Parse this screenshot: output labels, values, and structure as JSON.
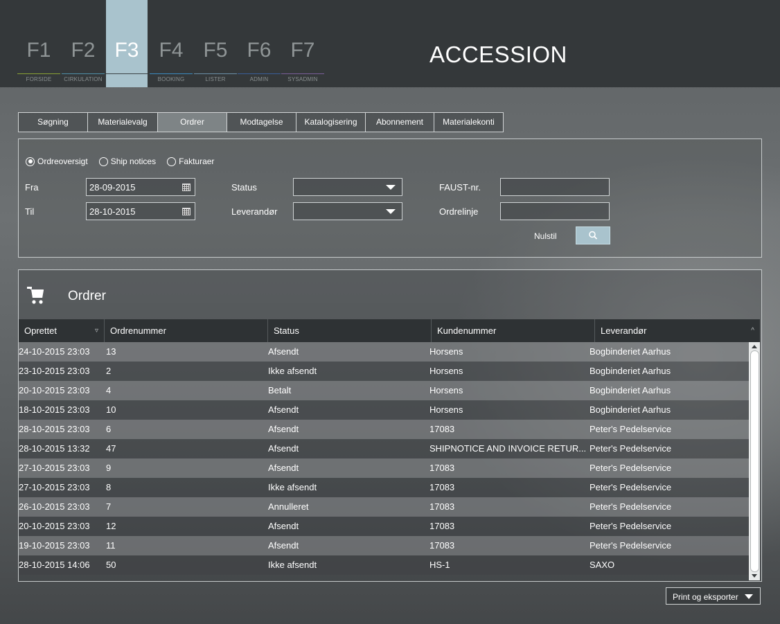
{
  "nav": {
    "keys": [
      {
        "key": "F1",
        "label": "FORSIDE",
        "color": "#8aa234"
      },
      {
        "key": "F2",
        "label": "CIRKULATION",
        "color": "#4f8fa8"
      },
      {
        "key": "F3",
        "label": "",
        "color": "#a9c3cd"
      },
      {
        "key": "F4",
        "label": "BOOKING",
        "color": "#3b8bbf"
      },
      {
        "key": "F5",
        "label": "LISTER",
        "color": "#6a8fa8"
      },
      {
        "key": "F6",
        "label": "ADMIN",
        "color": "#3a5f9a"
      },
      {
        "key": "F7",
        "label": "SYSADMIN",
        "color": "#7a5f9a"
      }
    ],
    "active": "F3",
    "title": "ACCESSION"
  },
  "tabs": [
    {
      "label": "Søgning"
    },
    {
      "label": "Materialevalg"
    },
    {
      "label": "Ordrer",
      "active": true
    },
    {
      "label": "Modtagelse"
    },
    {
      "label": "Katalogisering"
    },
    {
      "label": "Abonnement"
    },
    {
      "label": "Materialekonti"
    }
  ],
  "filter": {
    "view_options": [
      "Ordreoversigt",
      "Ship notices",
      "Fakturaer"
    ],
    "selected_view": "Ordreoversigt",
    "from_label": "Fra",
    "from_value": "28-09-2015",
    "to_label": "Til",
    "to_value": "28-10-2015",
    "status_label": "Status",
    "status_value": "",
    "supplier_label": "Leverandør",
    "supplier_value": "",
    "faust_label": "FAUST-nr.",
    "faust_value": "",
    "orderline_label": "Ordrelinje",
    "orderline_value": "",
    "reset_label": "Nulstil",
    "search_icon": "search-icon"
  },
  "orders": {
    "title": "Ordrer",
    "icon": "cart-icon",
    "columns": [
      "Oprettet",
      "Ordrenummer",
      "Status",
      "Kundenummer",
      "Leverandør"
    ],
    "rows": [
      [
        "24-10-2015 23:03",
        "13",
        "Afsendt",
        "Horsens",
        "Bogbinderiet Aarhus"
      ],
      [
        "23-10-2015 23:03",
        "2",
        "Ikke afsendt",
        "Horsens",
        "Bogbinderiet Aarhus"
      ],
      [
        "20-10-2015 23:03",
        "4",
        "Betalt",
        "Horsens",
        "Bogbinderiet Aarhus"
      ],
      [
        "18-10-2015 23:03",
        "10",
        "Afsendt",
        "Horsens",
        "Bogbinderiet Aarhus"
      ],
      [
        "28-10-2015 23:03",
        "6",
        "Afsendt",
        "17083",
        "Peter's Pedelservice"
      ],
      [
        "28-10-2015 13:32",
        "47",
        "Afsendt",
        "SHIPNOTICE AND INVOICE RETUR...",
        "Peter's Pedelservice"
      ],
      [
        "27-10-2015 23:03",
        "9",
        "Afsendt",
        "17083",
        "Peter's Pedelservice"
      ],
      [
        "27-10-2015 23:03",
        "8",
        "Ikke afsendt",
        "17083",
        "Peter's Pedelservice"
      ],
      [
        "26-10-2015 23:03",
        "7",
        "Annulleret",
        "17083",
        "Peter's Pedelservice"
      ],
      [
        "20-10-2015 23:03",
        "12",
        "Afsendt",
        "17083",
        "Peter's Pedelservice"
      ],
      [
        "19-10-2015 23:03",
        "11",
        "Afsendt",
        "17083",
        "Peter's Pedelservice"
      ],
      [
        "28-10-2015 14:06",
        "50",
        "Ikke afsendt",
        "HS-1",
        "SAXO"
      ]
    ]
  },
  "print_label": "Print og eksporter"
}
